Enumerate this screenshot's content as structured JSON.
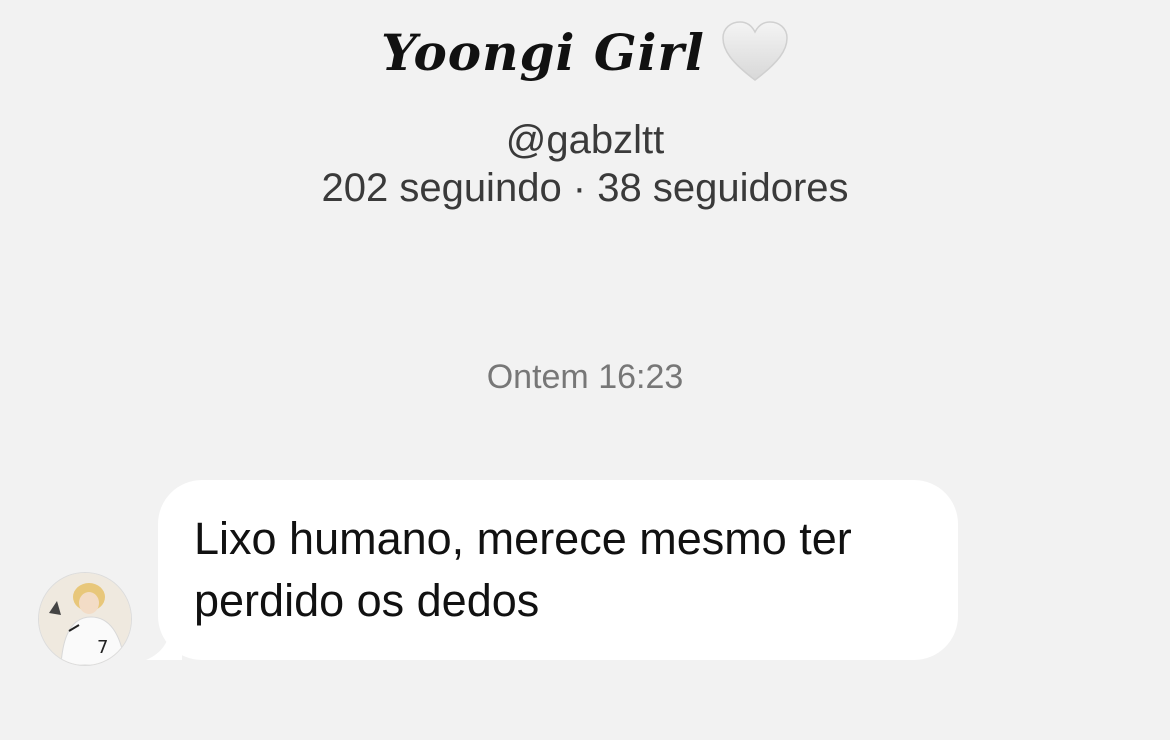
{
  "profile": {
    "display_name": "Yoongi Girl",
    "username": "@gabzltt",
    "stats": "202 seguindo · 38 seguidores"
  },
  "icons": {
    "name_emoji": "white-heart-icon",
    "avatar": "avatar-image"
  },
  "conversation": {
    "timestamp": "Ontem 16:23",
    "messages": [
      {
        "text": "Lixo humano, merece mesmo ter perdido os dedos"
      }
    ]
  },
  "colors": {
    "background": "#f2f2f2",
    "bubble": "#ffffff",
    "text_primary": "#111111",
    "text_secondary": "#3a3a3a",
    "timestamp": "#777777"
  }
}
